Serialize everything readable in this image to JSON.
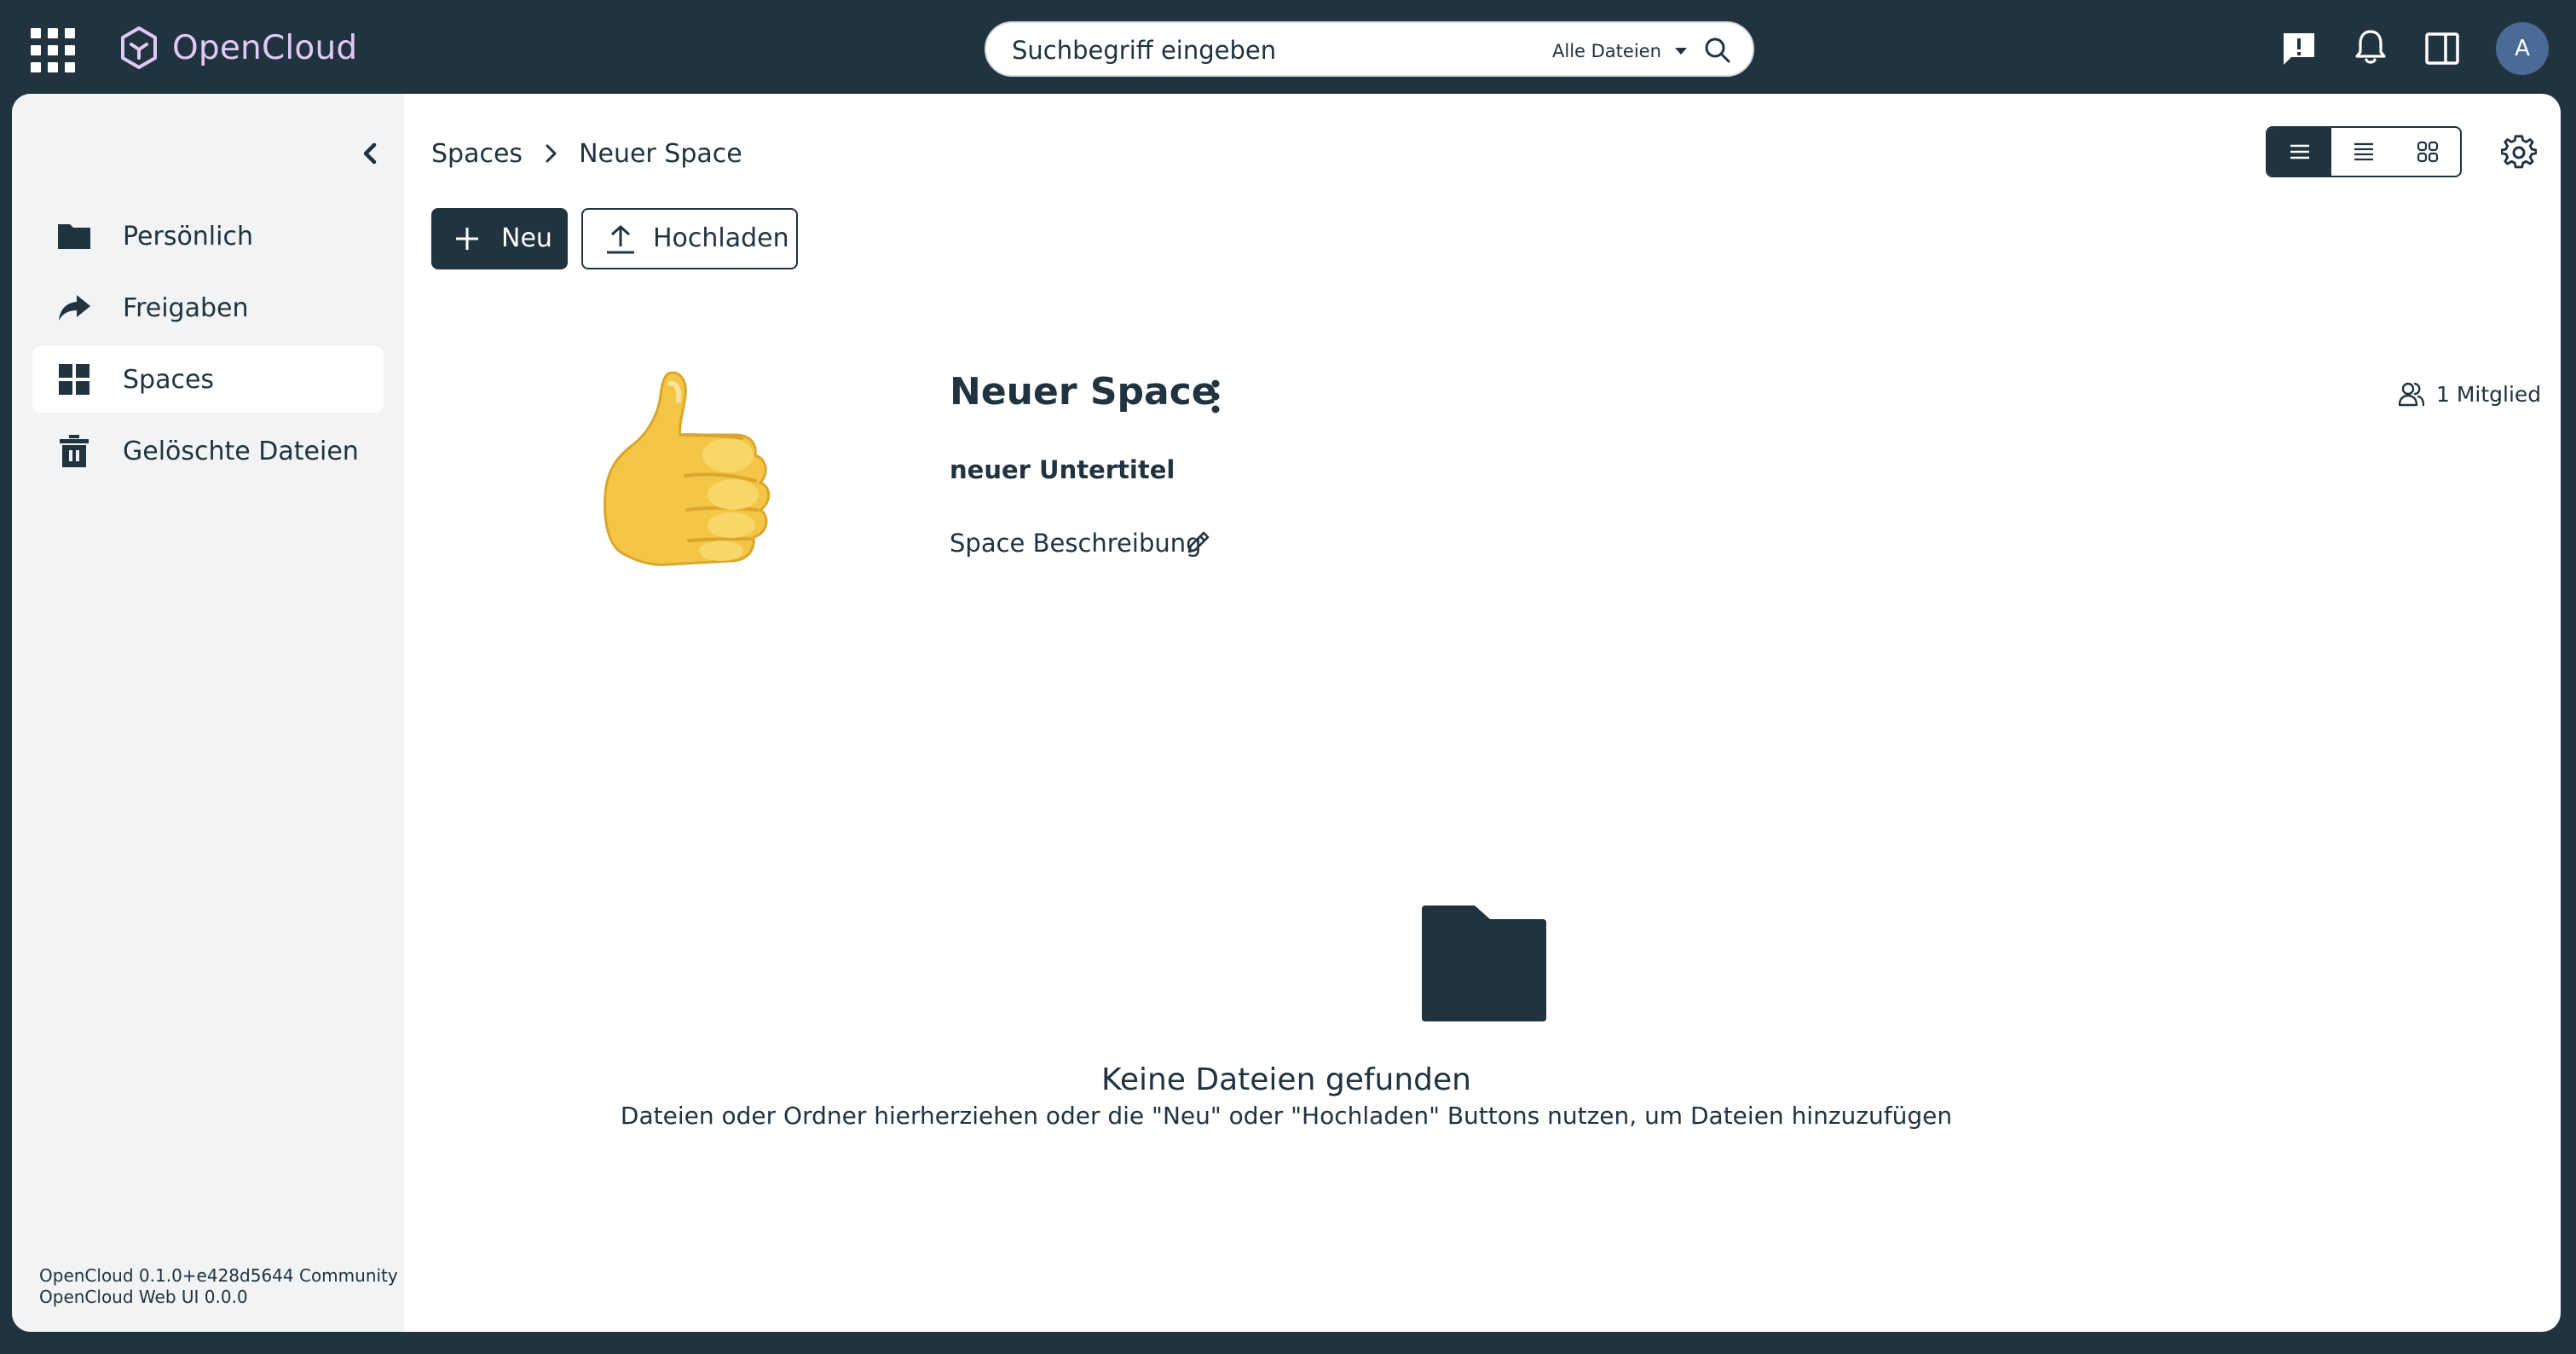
{
  "app": {
    "name": "OpenCloud"
  },
  "search": {
    "placeholder": "Suchbegriff eingeben",
    "scope": "Alle Dateien"
  },
  "user": {
    "avatar_initial": "A"
  },
  "sidebar": {
    "items": [
      {
        "label": "Persönlich",
        "icon": "folder-icon"
      },
      {
        "label": "Freigaben",
        "icon": "share-icon"
      },
      {
        "label": "Spaces",
        "icon": "grid-icon",
        "active": true
      },
      {
        "label": "Gelöschte Dateien",
        "icon": "trash-icon"
      }
    ],
    "version_line1": "OpenCloud 0.1.0+e428d5644 Community",
    "version_line2": "OpenCloud Web UI 0.0.0"
  },
  "breadcrumb": {
    "root": "Spaces",
    "current": "Neuer Space"
  },
  "toolbar": {
    "new_label": "Neu",
    "upload_label": "Hochladen"
  },
  "view_modes": {
    "active": "list"
  },
  "space": {
    "title": "Neuer Space",
    "subtitle": "neuer Untertitel",
    "description": "Space Beschreibung",
    "members": "1 Mitglied",
    "image": "thumbs-up-emoji"
  },
  "empty_state": {
    "title": "Keine Dateien gefunden",
    "hint": "Dateien oder Ordner hierherziehen oder die \"Neu\" oder \"Hochladen\" Buttons nutzen, um Dateien hinzuzufügen"
  },
  "colors": {
    "primary": "#20333f",
    "logo": "#e2c9f5",
    "sidebar_bg": "#f1f3f4",
    "avatar": "#4a6b95"
  }
}
